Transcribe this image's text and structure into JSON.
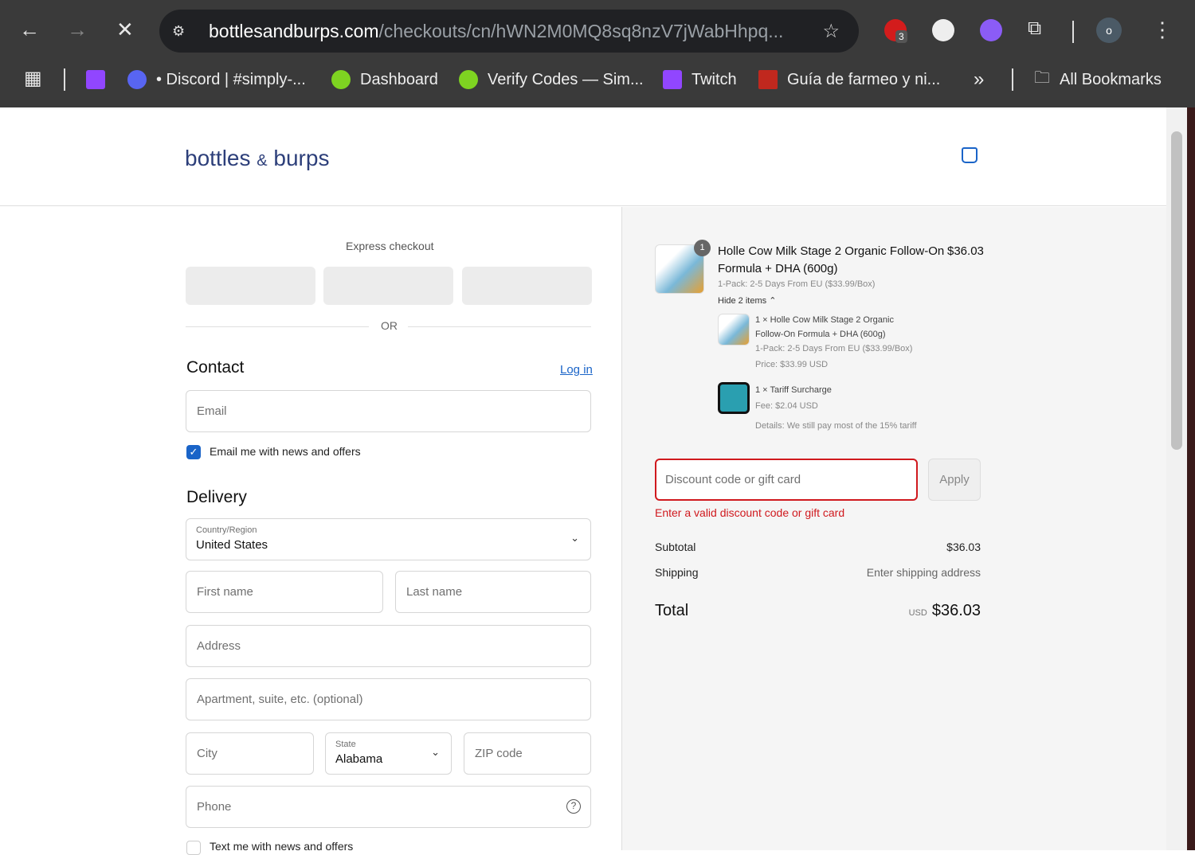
{
  "browser": {
    "url_domain": "bottlesandburps.com",
    "url_path": "/checkouts/cn/hWN2M0MQ8sq8nzV7jWabHhpq...",
    "ext_badge": "3",
    "profile_initial": "o",
    "bookmarks": [
      "• Discord | #simply-...",
      "Dashboard",
      "Verify Codes — Sim...",
      "Twitch",
      "Guía de farmeo y ni..."
    ],
    "more": "»",
    "all_bookmarks": "All Bookmarks"
  },
  "header": {
    "logo_a": "bottles",
    "logo_amp": "&",
    "logo_b": "burps"
  },
  "express": {
    "title": "Express checkout",
    "or": "OR"
  },
  "contact": {
    "title": "Contact",
    "login": "Log in",
    "email_ph": "Email",
    "news_label": "Email me with news and offers",
    "news_checked": true
  },
  "delivery": {
    "title": "Delivery",
    "country_label": "Country/Region",
    "country": "United States",
    "first_ph": "First name",
    "last_ph": "Last name",
    "address_ph": "Address",
    "apt_ph": "Apartment, suite, etc. (optional)",
    "city_ph": "City",
    "state_label": "State",
    "state": "Alabama",
    "zip_ph": "ZIP code",
    "phone_ph": "Phone",
    "text_label": "Text me with news and offers"
  },
  "summary": {
    "qty_badge": "1",
    "product": "Holle Cow Milk Stage 2 Organic Follow-On",
    "product2": "Formula + DHA (600g)",
    "price": "$36.03",
    "variant": "1-Pack: 2-5 Days From EU ($33.99/Box)",
    "hide": "Hide 2 items",
    "items": [
      {
        "l1": "1 × Holle Cow Milk Stage 2 Organic",
        "l2": "Follow-On Formula + DHA (600g)",
        "l3": "1-Pack: 2-5 Days From EU ($33.99/Box)",
        "l4": "Price: $33.99 USD"
      },
      {
        "l1": "1 × Tariff Surcharge",
        "l2": "Fee: $2.04 USD",
        "l3": "Details: We still pay most of the 15% tariff"
      }
    ],
    "discount_ph": "Discount code or gift card",
    "apply": "Apply",
    "error": "Enter a valid discount code or gift card",
    "subtotal_label": "Subtotal",
    "subtotal": "$36.03",
    "shipping_label": "Shipping",
    "shipping": "Enter shipping address",
    "total_label": "Total",
    "currency": "USD",
    "total": "$36.03"
  },
  "colors": {
    "accent": "#1a64c8",
    "error": "#d0191e"
  }
}
